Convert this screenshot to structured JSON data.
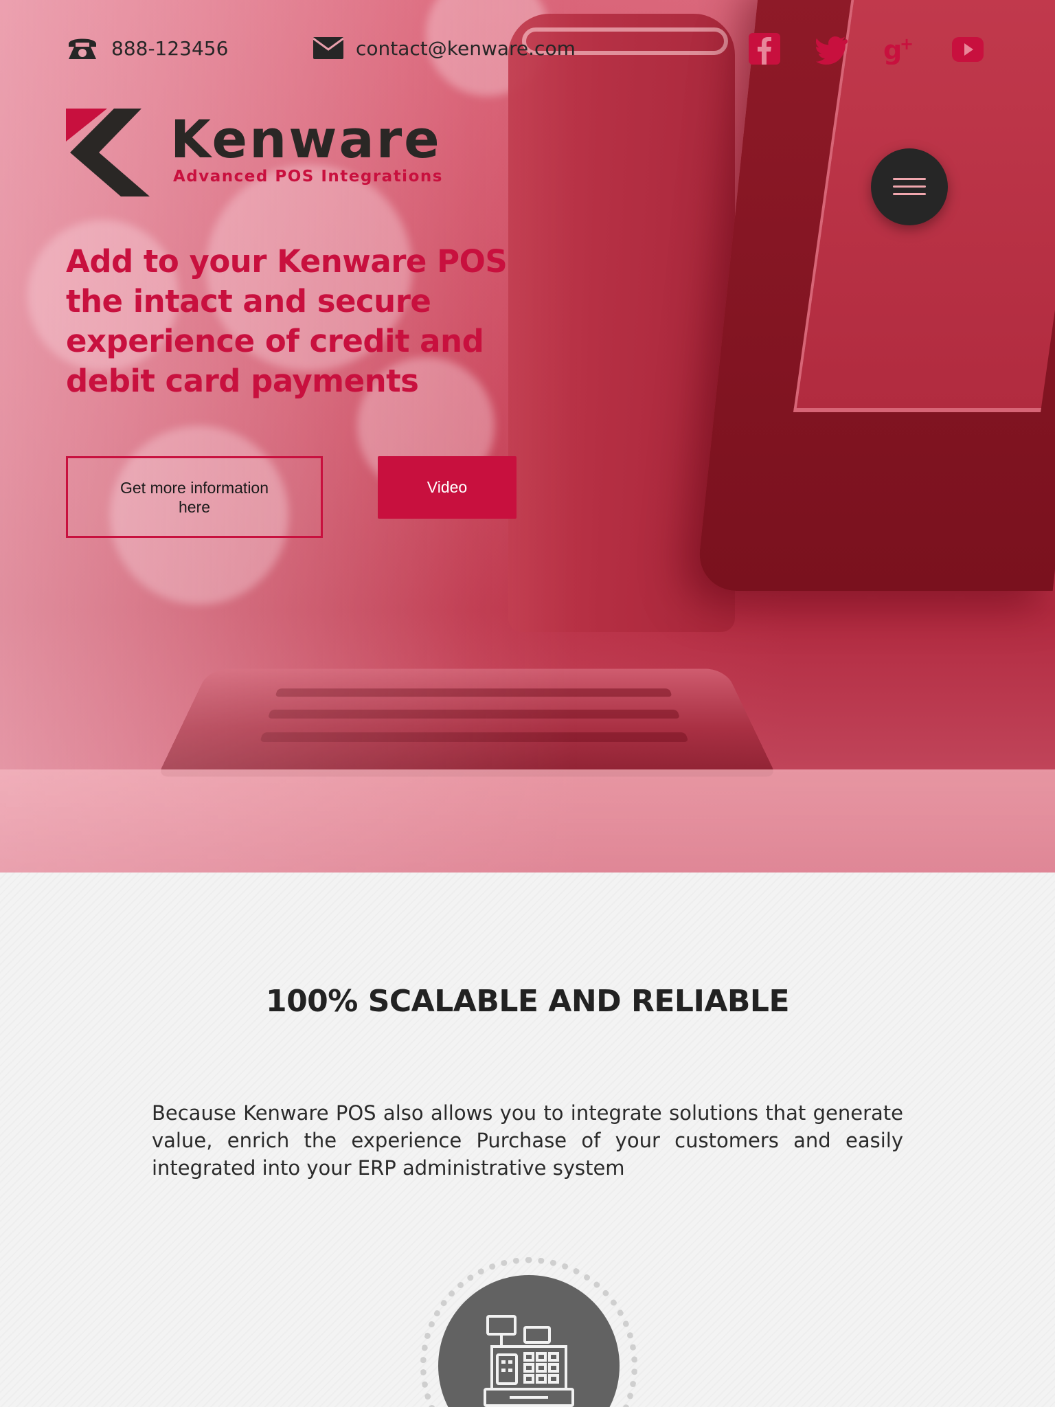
{
  "contact": {
    "phone": "888-123456",
    "email": "contact@kenware.com"
  },
  "social": [
    "facebook-icon",
    "twitter-icon",
    "google-plus-icon",
    "youtube-icon"
  ],
  "brand": {
    "name": "Kenware",
    "tagline": "Advanced POS Integrations",
    "accent_color": "#c8103e",
    "dark_color": "#2a2725"
  },
  "hero": {
    "headline": "Add to your Kenware POS the intact and secure experience of credit and debit card payments",
    "primary_button": "Get more information here",
    "video_button": "Video"
  },
  "section": {
    "title": "100% SCALABLE AND RELIABLE",
    "text": "Because Kenware POS also allows you to integrate solutions that generate value, enrich the experience Purchase of your customers and easily integrated into your ERP administrative system",
    "icon": "cash-register-icon"
  }
}
